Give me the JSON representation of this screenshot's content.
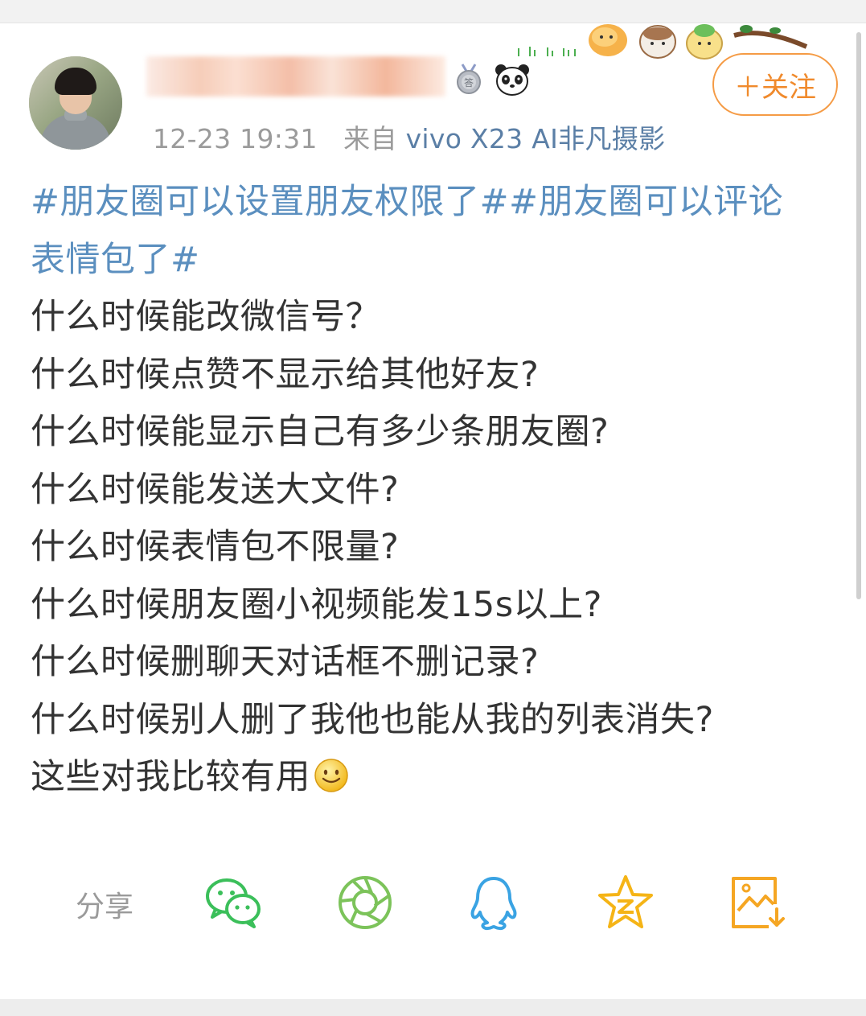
{
  "post": {
    "timestamp": "12-23 19:31",
    "via_label": "来自",
    "device": "vivo X23 AI非凡摄影",
    "follow_label": "＋关注",
    "topics_line1": "#朋友圈可以设置朋友权限了##朋友圈可以评论",
    "topics_line2": "表情包了#",
    "lines": [
      "什么时候能改微信号？",
      "什么时候点赞不显示给其他好友?",
      "什么时候能显示自己有多少条朋友圈?",
      "什么时候能发送大文件?",
      "什么时候表情包不限量?",
      "什么时候朋友圈小视频能发15s以上?",
      "什么时候删聊天对话框不删记录?",
      "什么时候别人删了我他也能从我的列表消失?",
      "这些对我比较有用"
    ],
    "badge_icons": [
      "medal-icon",
      "panda-icon"
    ],
    "end_emoji": "smile-icon"
  },
  "share": {
    "label": "分享",
    "targets": [
      {
        "icon": "wechat-icon",
        "color": "#3bbf5a"
      },
      {
        "icon": "moments-icon",
        "color": "#7cc35a"
      },
      {
        "icon": "qq-icon",
        "color": "#3aa3e3"
      },
      {
        "icon": "qzone-icon",
        "color": "#f5b416"
      },
      {
        "icon": "save-image-icon",
        "color": "#f5a623"
      }
    ]
  },
  "colors": {
    "topic": "#5b8fbf",
    "follow": "#f08a2c",
    "meta": "#9b9b9b"
  }
}
